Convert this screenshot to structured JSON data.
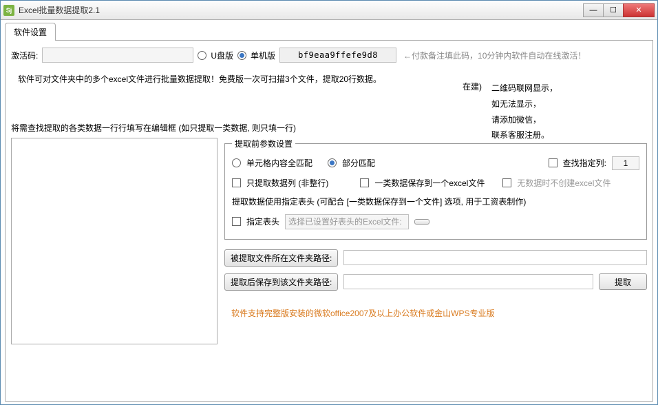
{
  "window": {
    "app_icon_text": "Sj",
    "title": "Excel批量数据提取2.1",
    "min": "—",
    "max": "☐",
    "close": "✕"
  },
  "tab_label": "软件设置",
  "activation": {
    "label": "激活码:",
    "input_value": "",
    "radio_usb": "U盘版",
    "radio_single": "单机版",
    "code": "bf9eaa9ffefe9d8",
    "hint": "←付款备注填此码，10分钟内软件自动在线激活！"
  },
  "build_label": "在建)",
  "description": "软件可对文件夹中的多个excel文件进行批量数据提取！免费版一次可扫描3个文件，提取20行数据。",
  "side_note": {
    "l1": "二维码联网显示，",
    "l2": "如无法显示，",
    "l3": "请添加微信，",
    "l4": "联系客服注册。"
  },
  "section_label": "将需查找提取的各类数据一行行填写在编辑框 (如只提取一类数据, 则只填一行)",
  "params": {
    "legend": "提取前参数设置",
    "radio_full_match": "单元格内容全匹配",
    "radio_partial_match": "部分匹配",
    "cb_search_col": "查找指定列:",
    "col_value": "1",
    "cb_col_only": "只提取数据列 (非整行)",
    "cb_one_file": "一类数据保存到一个excel文件",
    "cb_no_create": "无数据时不创建excel文件",
    "header_tip": "提取数据使用指定表头 (可配合 [一类数据保存到一个文件] 选项, 用于工资表制作)",
    "cb_fixed_header": "指定表头",
    "header_placeholder": "选择已设置好表头的Excel文件:"
  },
  "paths": {
    "source_btn": "被提取文件所在文件夹路径:",
    "save_btn": "提取后保存到该文件夹路径:",
    "extract_btn": "提取"
  },
  "footer": "软件支持完整版安装的微软office2007及以上办公软件或金山WPS专业版"
}
